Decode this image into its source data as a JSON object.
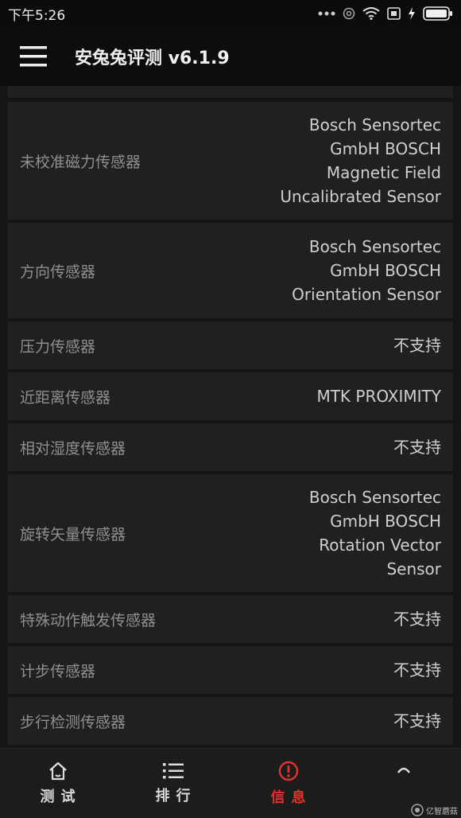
{
  "status": {
    "time": "下午5:26"
  },
  "appbar": {
    "title": "安兔兔评测 v6.1.9",
    "menu_icon": "hamburger-menu-icon"
  },
  "rows": [
    {
      "label": "未校准磁力传感器",
      "value": "Bosch Sensortec\nGmbH BOSCH\nMagnetic Field\nUncalibrated Sensor"
    },
    {
      "label": "方向传感器",
      "value": "Bosch Sensortec\nGmbH BOSCH\nOrientation Sensor"
    },
    {
      "label": "压力传感器",
      "value": "不支持"
    },
    {
      "label": "近距离传感器",
      "value": "MTK PROXIMITY"
    },
    {
      "label": "相对湿度传感器",
      "value": "不支持"
    },
    {
      "label": "旋转矢量传感器",
      "value": "Bosch Sensortec\nGmbH BOSCH\nRotation Vector\nSensor"
    },
    {
      "label": "特殊动作触发传感器",
      "value": "不支持"
    },
    {
      "label": "计步传感器",
      "value": "不支持"
    },
    {
      "label": "步行检测传感器",
      "value": "不支持"
    }
  ],
  "nav": {
    "test": "测试",
    "rank": "排行",
    "info": "信息",
    "active": "info",
    "active_color": "#e0322b"
  },
  "watermark": {
    "text": "亿智蘑菇"
  }
}
